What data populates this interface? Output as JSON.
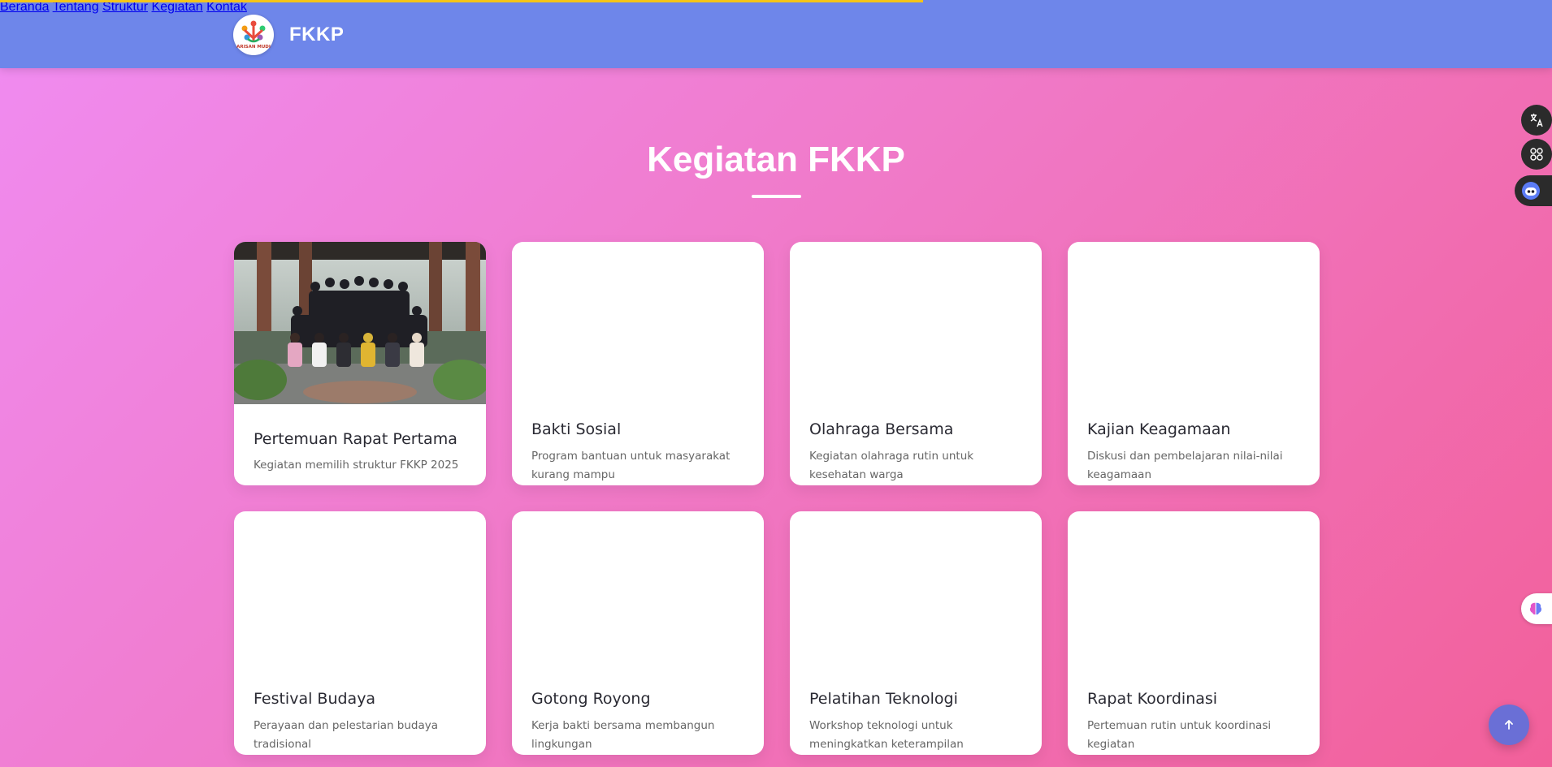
{
  "brand": {
    "name": "FKKP",
    "logo_text": "ARISAN MUDI"
  },
  "nav": {
    "items": [
      "Beranda",
      "Tentang",
      "Struktur",
      "Kegiatan",
      "Kontak"
    ]
  },
  "section": {
    "title": "Kegiatan FKKP"
  },
  "activities": [
    {
      "title": "Pertemuan Rapat Pertama",
      "desc": "Kegiatan memilih struktur FKKP 2025",
      "has_photo": true
    },
    {
      "title": "Bakti Sosial",
      "desc": "Program bantuan untuk masyarakat kurang mampu"
    },
    {
      "title": "Olahraga Bersama",
      "desc": "Kegiatan olahraga rutin untuk kesehatan warga"
    },
    {
      "title": "Kajian Keagamaan",
      "desc": "Diskusi dan pembelajaran nilai-nilai keagamaan"
    },
    {
      "title": "Festival Budaya",
      "desc": "Perayaan dan pelestarian budaya tradisional"
    },
    {
      "title": "Gotong Royong",
      "desc": "Kerja bakti bersama membangun lingkungan"
    },
    {
      "title": "Pelatihan Teknologi",
      "desc": "Workshop teknologi untuk meningkatkan keterampilan"
    },
    {
      "title": "Rapat Koordinasi",
      "desc": "Pertemuan rutin untuk koordinasi kegiatan"
    }
  ],
  "scroll_progress": 0.595,
  "icons": {
    "translate": "translate-icon",
    "apps": "apps-grid-icon",
    "assistant": "robot-assistant-icon",
    "brain": "brain-icon",
    "scroll_top": "arrow-up-icon"
  },
  "colors": {
    "navbar": "#6e86ea",
    "progress": "#f5c518",
    "gradient_start": "#f08cf2",
    "gradient_end": "#f2609a",
    "scroll_top": "#6a6fd6"
  }
}
